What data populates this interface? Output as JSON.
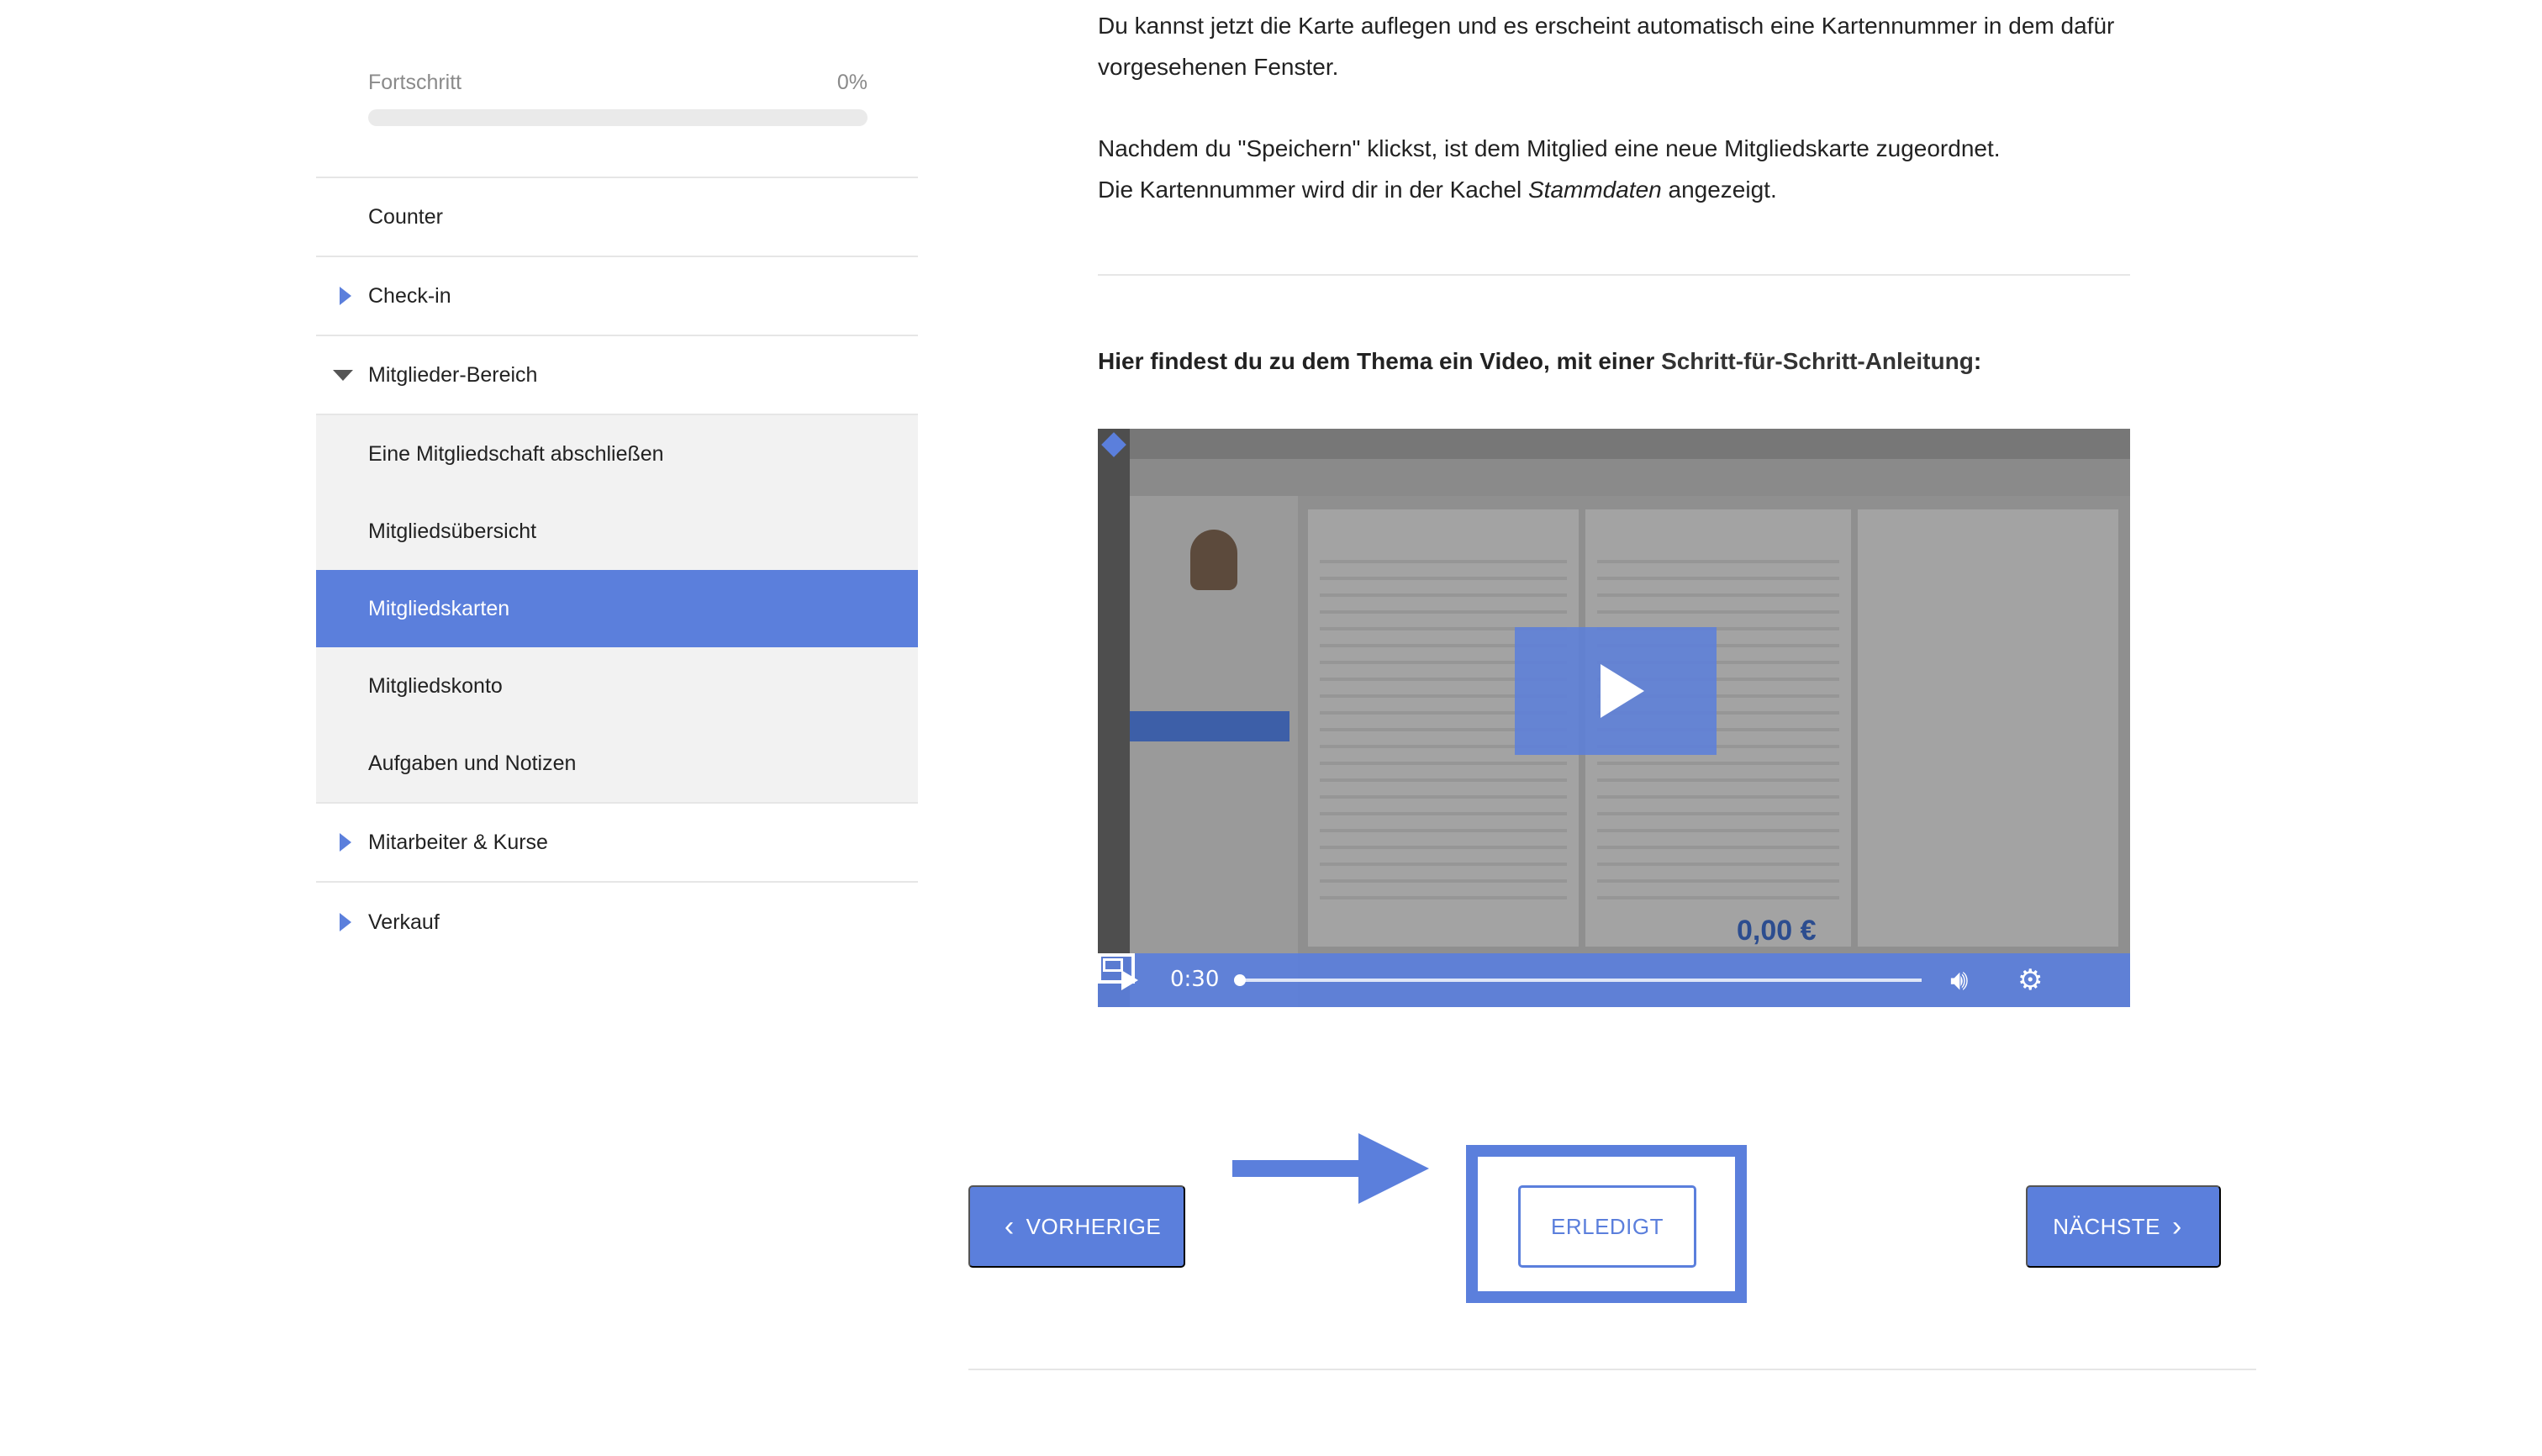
{
  "sidebar": {
    "progress": {
      "label": "Fortschritt",
      "percent_text": "0%",
      "value": 0
    },
    "items": [
      {
        "label": "Counter",
        "expandable": false
      },
      {
        "label": "Check-in",
        "expandable": true,
        "expanded": false
      },
      {
        "label": "Mitglieder-Bereich",
        "expandable": true,
        "expanded": true
      },
      {
        "label": "Mitarbeiter & Kurse",
        "expandable": true,
        "expanded": false
      },
      {
        "label": "Verkauf",
        "expandable": true,
        "expanded": false
      }
    ],
    "subitems": [
      {
        "label": "Eine Mitgliedschaft abschließen",
        "active": false
      },
      {
        "label": "Mitgliedsübersicht",
        "active": false
      },
      {
        "label": "Mitgliedskarten",
        "active": true
      },
      {
        "label": "Mitgliedskonto",
        "active": false
      },
      {
        "label": "Aufgaben und Notizen",
        "active": false
      }
    ]
  },
  "content": {
    "p1": "Du kannst jetzt die Karte auflegen und es erscheint automatisch eine Kartennummer in dem dafür vorgesehenen Fenster.",
    "p2_line1": "Nachdem du \"Speichern\" klickst, ist dem Mitglied eine neue Mitgliedskarte zugeordnet.",
    "p2_line2_pre": "Die Kartennummer wird dir in der Kachel ",
    "p2_line2_em": "Stammdaten",
    "p2_line2_post": " angezeigt.",
    "video_heading_pre": "Hier findest du zu dem Thema ein Video, mit einer ",
    "video_heading_link": "Schritt-für-Schritt-Anleitung",
    "video_heading_post": ":"
  },
  "video": {
    "time": "0:30",
    "progress": 0,
    "amount": "0,00 €"
  },
  "navigation": {
    "prev_label": "VORHERIGE",
    "done_label": "ERLEDIGT",
    "next_label": "NÄCHSTE"
  },
  "colors": {
    "accent": "#5b7fdc",
    "active_bg": "#5b7fdc",
    "sublist_bg": "#f2f2f2",
    "divider": "#e6e6e6"
  },
  "icons": {
    "expand_collapsed": "triangle-right-icon",
    "expand_open": "triangle-down-icon",
    "prev": "chevron-left-icon",
    "next": "chevron-right-icon",
    "annotation_arrow": "arrow-right-icon"
  }
}
